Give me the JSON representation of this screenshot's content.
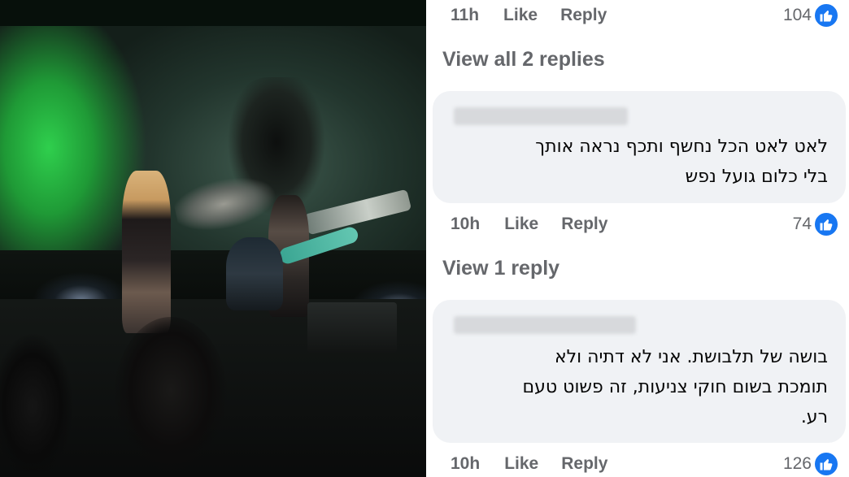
{
  "comments_panel": {
    "top_meta": {
      "time": "11h",
      "like": "Like",
      "reply": "Reply",
      "reaction_count": "104"
    },
    "view_replies_1": "View all 2 replies",
    "comment_1": {
      "text_line_1": "לאט לאט הכל נחשף ותכף נראה אותך",
      "text_line_2": "בלי כלום גועל נפש",
      "meta": {
        "time": "10h",
        "like": "Like",
        "reply": "Reply",
        "reaction_count": "74"
      }
    },
    "view_replies_2": "View 1 reply",
    "comment_2": {
      "text_line_1": "בושה של תלבושת. אני לא דתיה ולא",
      "text_line_2": "תומכת בשום חוקי צניעות, זה פשוט טעם",
      "text_line_3": "רע.",
      "meta": {
        "time": "10h",
        "like": "Like",
        "reply": "Reply",
        "reaction_count": "126"
      }
    }
  },
  "colors": {
    "like_blue": "#1877f2",
    "bubble_bg": "#f0f2f5",
    "meta_gray": "#65676b"
  }
}
